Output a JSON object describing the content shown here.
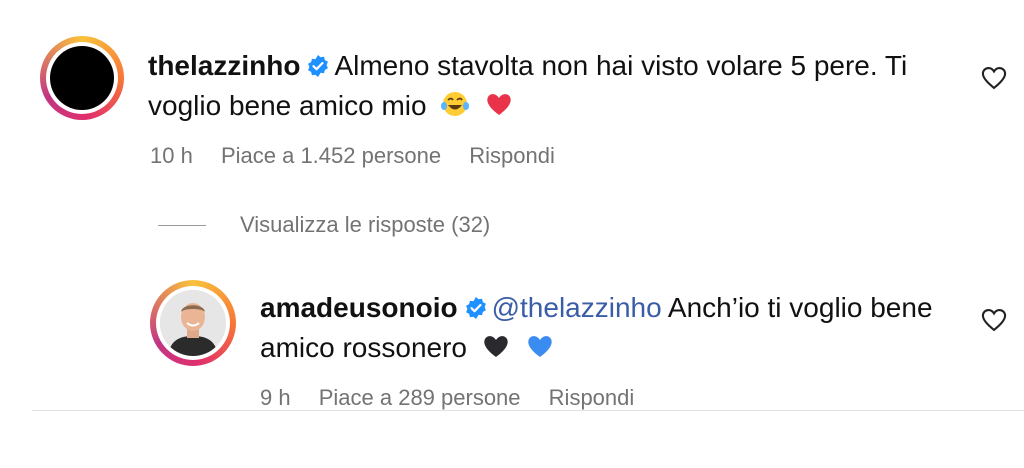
{
  "comments": [
    {
      "username": "thelazzinho",
      "text_line1": "Almeno stavolta non hai visto volare 5 pere. Ti",
      "text_line2": "voglio bene amico mio",
      "emojis": [
        "tears-of-joy-emoji",
        "red-heart-emoji"
      ],
      "time": "10 h",
      "likes": "Piace a 1.452 persone",
      "reply": "Rispondi"
    },
    {
      "username": "amadeusonoio",
      "mention": "@thelazzinho",
      "text_line1": "Anch’io ti voglio bene",
      "text_line2": "amico rossonero",
      "emojis": [
        "black-heart-emoji",
        "blue-heart-emoji"
      ],
      "time": "9 h",
      "likes": "Piace a 289 persone",
      "reply": "Rispondi"
    }
  ],
  "view_replies": "Visualizza le risposte (32)",
  "icons": {
    "verified": "verified-badge-icon",
    "like": "heart-outline-icon"
  },
  "colors": {
    "verified_blue": "#1e90ff",
    "mention": "#3a5da8",
    "meta_gray": "#737373"
  }
}
